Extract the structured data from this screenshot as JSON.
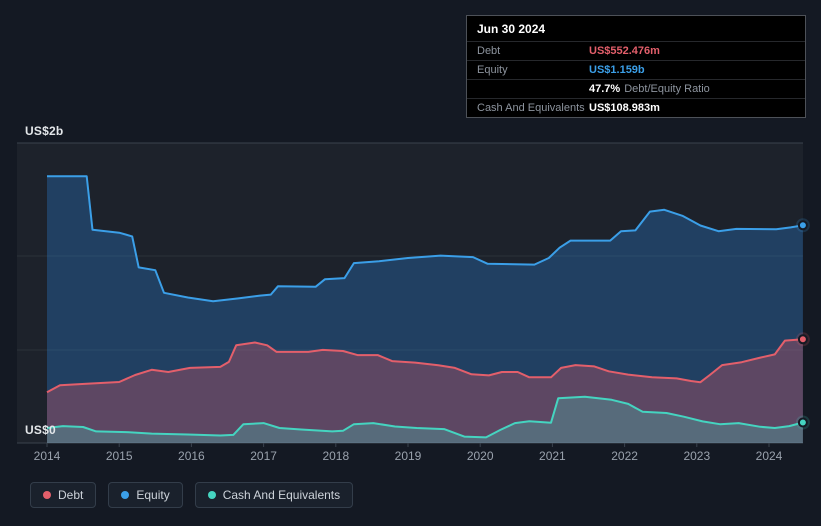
{
  "tooltip": {
    "date": "Jun 30 2024",
    "rows": {
      "debt_label": "Debt",
      "debt_value": "US$552.476m",
      "equity_label": "Equity",
      "equity_value": "US$1.159b",
      "ratio_value": "47.7%",
      "ratio_label": "Debt/Equity Ratio",
      "cash_label": "Cash And Equivalents",
      "cash_value": "US$108.983m"
    }
  },
  "axis": {
    "y_top_label": "US$2b",
    "y_bottom_label": "US$0",
    "x_ticks": [
      "2014",
      "2015",
      "2016",
      "2017",
      "2018",
      "2019",
      "2020",
      "2021",
      "2022",
      "2023",
      "2024"
    ]
  },
  "legend": [
    {
      "label": "Debt",
      "color": "#e35f6b"
    },
    {
      "label": "Equity",
      "color": "#3b9fe8"
    },
    {
      "label": "Cash And Equivalents",
      "color": "#45d4c0"
    }
  ],
  "colors": {
    "background": "#141923",
    "grid_strong": "#3a424e",
    "debt": "#e35f6b",
    "equity": "#3b9fe8",
    "cash": "#45d4c0"
  },
  "chart_data": {
    "type": "area",
    "title": "Debt to Equity history",
    "units": "USD billions",
    "x_range": [
      2014,
      2024.5
    ],
    "ylim": [
      0,
      2
    ],
    "ylabel_top": "US$2b",
    "ylabel_bottom": "US$0",
    "grid": true,
    "legend_position": "bottom-left",
    "latest": {
      "date": "Jun 30 2024",
      "debt": 0.552476,
      "equity": 1.159,
      "debt_equity_ratio_pct": 47.7,
      "cash_and_equivalents": 0.108983
    },
    "series": [
      {
        "name": "Debt",
        "color": "#e35f6b",
        "fill": "rgba(233,90,102,0.30)",
        "points": [
          [
            2014.0,
            0.27
          ],
          [
            2014.18,
            0.308
          ],
          [
            2014.55,
            0.315
          ],
          [
            2015.0,
            0.325
          ],
          [
            2015.22,
            0.362
          ],
          [
            2015.45,
            0.39
          ],
          [
            2015.68,
            0.378
          ],
          [
            2015.98,
            0.4
          ],
          [
            2016.4,
            0.405
          ],
          [
            2016.52,
            0.432
          ],
          [
            2016.62,
            0.52
          ],
          [
            2016.88,
            0.535
          ],
          [
            2017.05,
            0.52
          ],
          [
            2017.18,
            0.485
          ],
          [
            2017.62,
            0.485
          ],
          [
            2017.82,
            0.496
          ],
          [
            2018.1,
            0.49
          ],
          [
            2018.3,
            0.468
          ],
          [
            2018.58,
            0.468
          ],
          [
            2018.78,
            0.436
          ],
          [
            2019.1,
            0.428
          ],
          [
            2019.42,
            0.414
          ],
          [
            2019.65,
            0.4
          ],
          [
            2019.88,
            0.366
          ],
          [
            2020.12,
            0.36
          ],
          [
            2020.3,
            0.378
          ],
          [
            2020.52,
            0.378
          ],
          [
            2020.68,
            0.35
          ],
          [
            2020.98,
            0.35
          ],
          [
            2021.12,
            0.4
          ],
          [
            2021.32,
            0.415
          ],
          [
            2021.58,
            0.408
          ],
          [
            2021.78,
            0.382
          ],
          [
            2022.05,
            0.364
          ],
          [
            2022.38,
            0.35
          ],
          [
            2022.72,
            0.344
          ],
          [
            2022.92,
            0.33
          ],
          [
            2023.05,
            0.324
          ],
          [
            2023.18,
            0.362
          ],
          [
            2023.35,
            0.415
          ],
          [
            2023.62,
            0.43
          ],
          [
            2023.88,
            0.455
          ],
          [
            2024.08,
            0.472
          ],
          [
            2024.22,
            0.545
          ],
          [
            2024.47,
            0.552
          ]
        ]
      },
      {
        "name": "Equity",
        "color": "#3b9fe8",
        "fill": "rgba(42,136,224,0.30)",
        "points": [
          [
            2014.0,
            1.42
          ],
          [
            2014.55,
            1.42
          ],
          [
            2014.63,
            1.135
          ],
          [
            2015.0,
            1.12
          ],
          [
            2015.18,
            1.1
          ],
          [
            2015.27,
            0.935
          ],
          [
            2015.5,
            0.92
          ],
          [
            2015.62,
            0.8
          ],
          [
            2015.95,
            0.775
          ],
          [
            2016.3,
            0.755
          ],
          [
            2016.65,
            0.77
          ],
          [
            2016.95,
            0.785
          ],
          [
            2017.1,
            0.79
          ],
          [
            2017.2,
            0.835
          ],
          [
            2017.72,
            0.832
          ],
          [
            2017.85,
            0.872
          ],
          [
            2018.12,
            0.878
          ],
          [
            2018.25,
            0.958
          ],
          [
            2018.6,
            0.968
          ],
          [
            2019.0,
            0.985
          ],
          [
            2019.45,
            0.998
          ],
          [
            2019.9,
            0.99
          ],
          [
            2020.1,
            0.955
          ],
          [
            2020.75,
            0.95
          ],
          [
            2020.95,
            0.985
          ],
          [
            2021.1,
            1.04
          ],
          [
            2021.25,
            1.078
          ],
          [
            2021.8,
            1.078
          ],
          [
            2021.95,
            1.128
          ],
          [
            2022.15,
            1.132
          ],
          [
            2022.35,
            1.232
          ],
          [
            2022.55,
            1.242
          ],
          [
            2022.8,
            1.21
          ],
          [
            2023.05,
            1.158
          ],
          [
            2023.3,
            1.128
          ],
          [
            2023.55,
            1.14
          ],
          [
            2024.1,
            1.138
          ],
          [
            2024.3,
            1.148
          ],
          [
            2024.47,
            1.159
          ]
        ]
      },
      {
        "name": "Cash And Equivalents",
        "color": "#45d4c0",
        "fill": "rgba(72,214,194,0.25)",
        "points": [
          [
            2014.0,
            0.08
          ],
          [
            2014.22,
            0.09
          ],
          [
            2014.5,
            0.085
          ],
          [
            2014.68,
            0.062
          ],
          [
            2015.1,
            0.058
          ],
          [
            2015.45,
            0.05
          ],
          [
            2015.95,
            0.045
          ],
          [
            2016.4,
            0.04
          ],
          [
            2016.58,
            0.043
          ],
          [
            2016.72,
            0.1
          ],
          [
            2017.0,
            0.106
          ],
          [
            2017.22,
            0.08
          ],
          [
            2017.52,
            0.072
          ],
          [
            2017.95,
            0.062
          ],
          [
            2018.1,
            0.065
          ],
          [
            2018.25,
            0.1
          ],
          [
            2018.52,
            0.106
          ],
          [
            2018.82,
            0.088
          ],
          [
            2019.12,
            0.08
          ],
          [
            2019.5,
            0.074
          ],
          [
            2019.78,
            0.034
          ],
          [
            2020.08,
            0.03
          ],
          [
            2020.28,
            0.07
          ],
          [
            2020.48,
            0.106
          ],
          [
            2020.68,
            0.116
          ],
          [
            2020.98,
            0.108
          ],
          [
            2021.08,
            0.238
          ],
          [
            2021.45,
            0.246
          ],
          [
            2021.82,
            0.23
          ],
          [
            2022.05,
            0.208
          ],
          [
            2022.25,
            0.166
          ],
          [
            2022.58,
            0.16
          ],
          [
            2022.82,
            0.14
          ],
          [
            2023.08,
            0.115
          ],
          [
            2023.32,
            0.1
          ],
          [
            2023.58,
            0.106
          ],
          [
            2023.88,
            0.086
          ],
          [
            2024.08,
            0.08
          ],
          [
            2024.28,
            0.09
          ],
          [
            2024.47,
            0.109
          ]
        ]
      }
    ]
  }
}
